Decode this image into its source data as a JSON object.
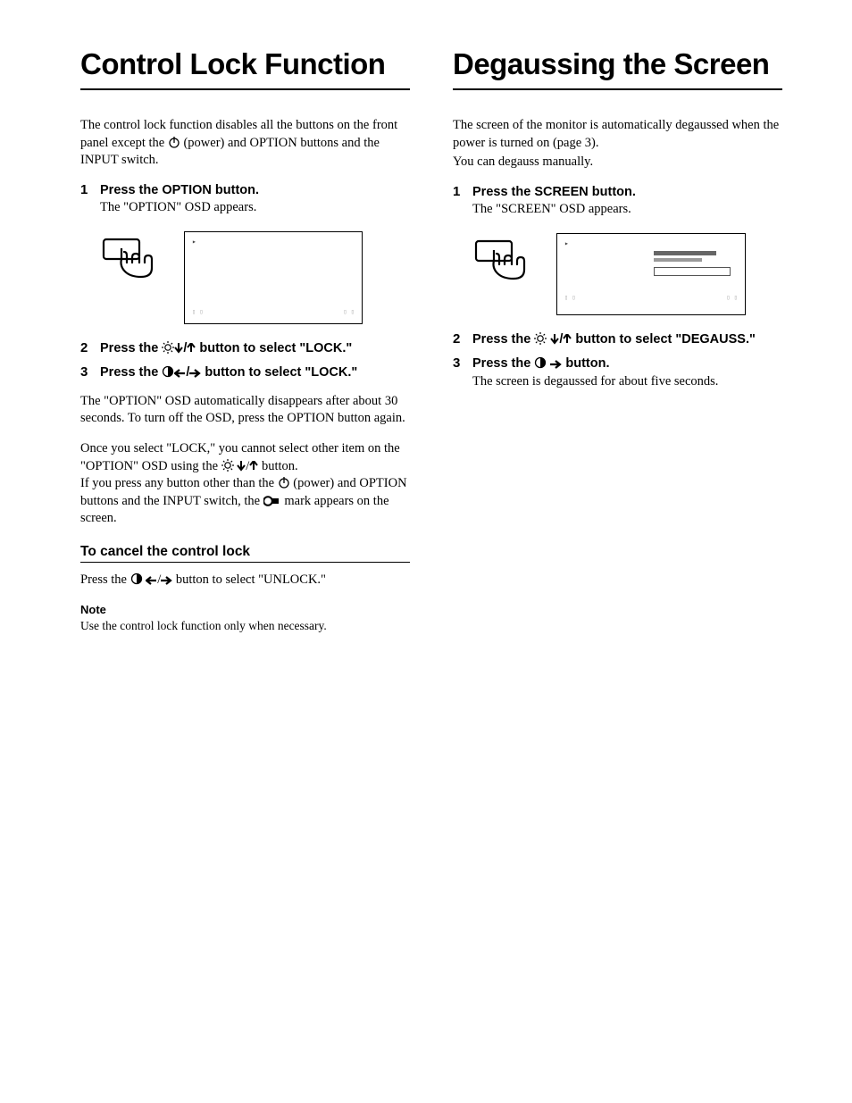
{
  "left": {
    "title": "Control Lock Function",
    "intro_a": "The control lock function disables all the buttons on the front panel except the ",
    "intro_b": " (power) and OPTION buttons and the INPUT switch.",
    "step1": {
      "num": "1",
      "head": "Press the OPTION button.",
      "sub": "The \"OPTION\" OSD appears."
    },
    "step2": {
      "num": "2",
      "head_a": "Press the ",
      "head_b": " button to select \"LOCK.\""
    },
    "step3": {
      "num": "3",
      "head_a": "Press the ",
      "head_b": " button to select \"LOCK.\""
    },
    "after_a": "The \"OPTION\" OSD automatically disappears after about 30 seconds. To turn off the OSD, press the OPTION button again.",
    "after_b1": "Once you select \"LOCK,\" you cannot select other item on the \"OPTION\" OSD using the ",
    "after_b2": " button.",
    "after_c1": "If you press any button other than the ",
    "after_c2": " (power) and OPTION buttons and the INPUT switch, the  ",
    "after_c3": "  mark appears on the screen.",
    "cancel_h": "To cancel the control lock",
    "cancel_a": "Press the ",
    "cancel_b": " button to select \"UNLOCK.\"",
    "note_h": "Note",
    "note_body": "Use the control lock function only when necessary."
  },
  "right": {
    "title": "Degaussing the Screen",
    "intro_a": "The screen of the monitor is automatically degaussed when the power is turned on (page 3).",
    "intro_b": "You can degauss manually.",
    "step1": {
      "num": "1",
      "head": "Press the SCREEN button.",
      "sub": "The \"SCREEN\" OSD appears."
    },
    "step2": {
      "num": "2",
      "head_a": "Press the ",
      "head_b": " button to select \"DEGAUSS.\""
    },
    "step3": {
      "num": "3",
      "head_a": "Press the ",
      "head_b": " button.",
      "sub": "The screen is degaussed for about five seconds."
    }
  }
}
